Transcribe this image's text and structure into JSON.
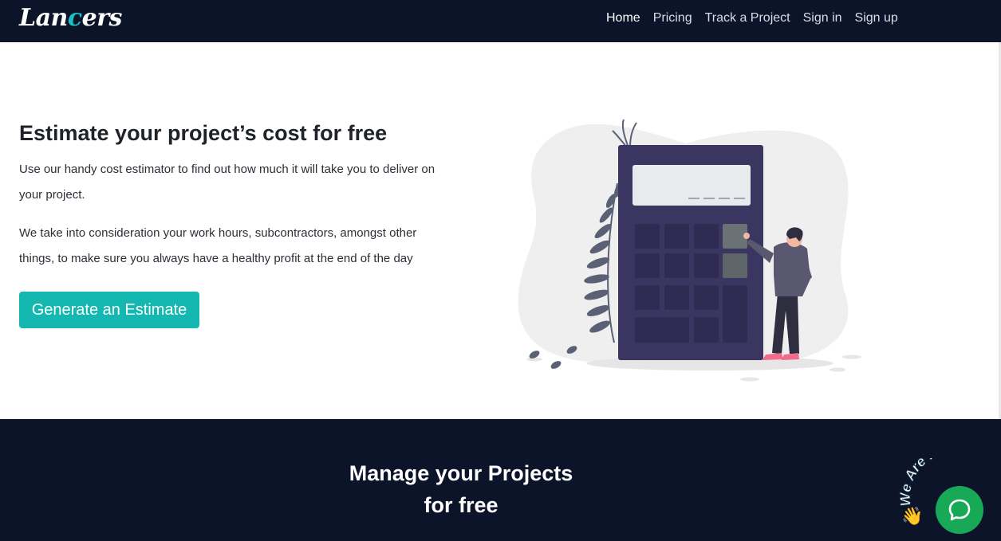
{
  "header": {
    "logo_part1": "Lan",
    "logo_part2": "c",
    "logo_part3": "ers",
    "nav": [
      {
        "label": "Home"
      },
      {
        "label": "Pricing"
      },
      {
        "label": "Track a Project"
      },
      {
        "label": "Sign in"
      },
      {
        "label": "Sign up"
      }
    ]
  },
  "hero": {
    "title": "Estimate your project’s cost for free",
    "paragraph1": "Use our handy cost estimator to find out how much it will take you to deliver on your project.",
    "paragraph2": "We take into consideration your work hours, subcontractors, amongst other things, to make sure you always have a healthy profit at the end of the day",
    "cta_label": "Generate an Estimate",
    "illustration_icon": "calculator-illustration"
  },
  "manage": {
    "line1": "Manage your Projects",
    "line2": "for free"
  },
  "chat": {
    "badge_text": "We Are Here!",
    "icon": "chat-bubble-icon"
  },
  "colors": {
    "nav_bg": "#0b1428",
    "accent": "#14b8b0",
    "calculator": "#3b3561",
    "chat_green": "#18a957"
  }
}
